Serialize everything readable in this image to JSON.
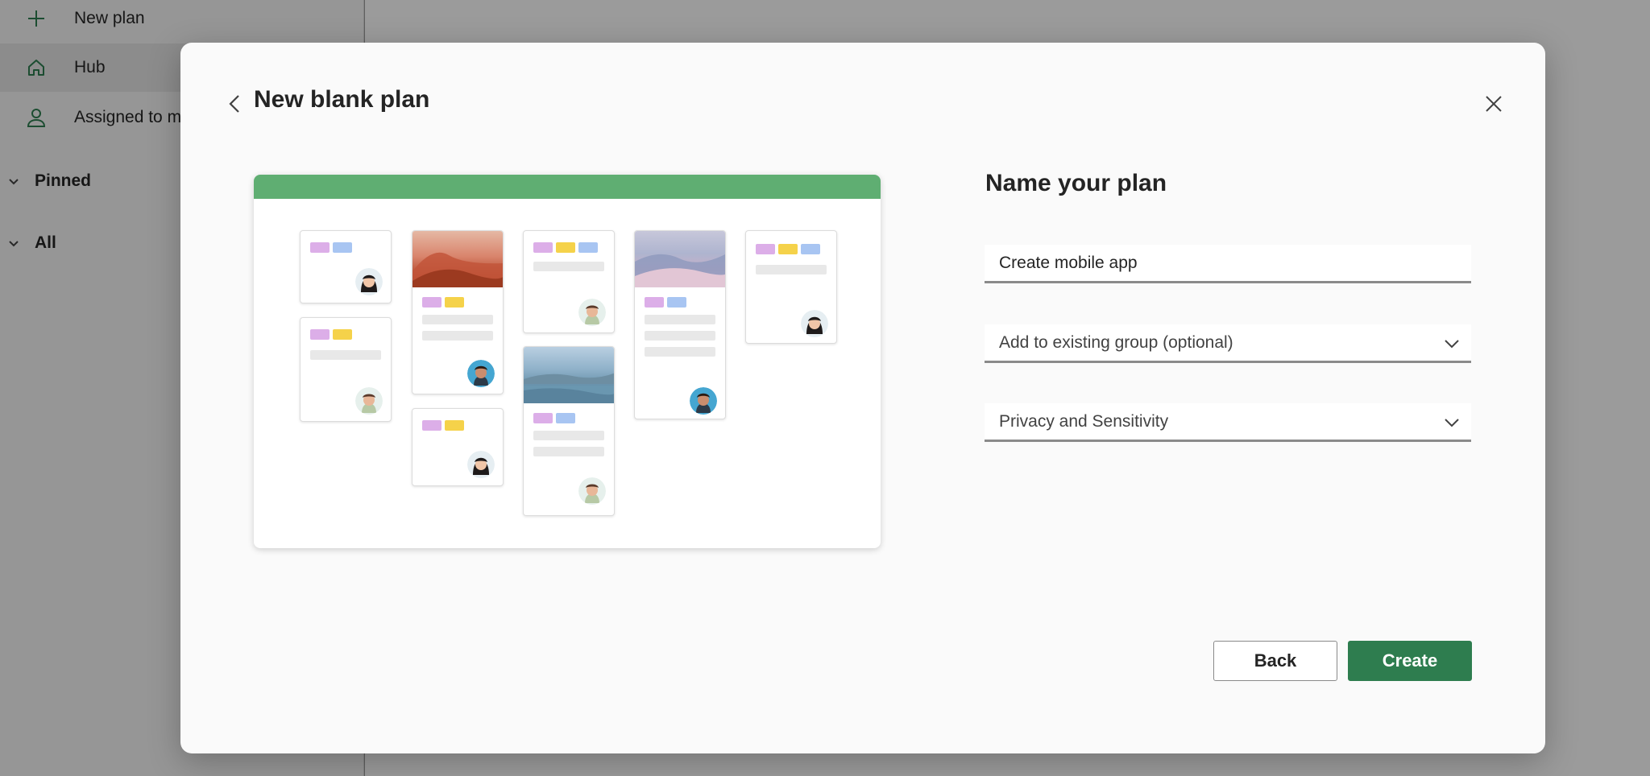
{
  "background_app": {
    "nav": [
      {
        "label": "New plan",
        "icon": "plus-icon"
      },
      {
        "label": "Hub",
        "icon": "home-icon",
        "active": true
      },
      {
        "label": "Assigned to me",
        "icon": "person-icon"
      }
    ],
    "sections": [
      {
        "label": "Pinned"
      },
      {
        "label": "All"
      }
    ]
  },
  "modal": {
    "title": "New blank plan",
    "back_icon": "chevron-left-icon",
    "close_icon": "close-icon",
    "illustration": {
      "header_color": "#5fae72",
      "description": "board-preview-illustration"
    },
    "form": {
      "heading": "Name your plan",
      "plan_name": {
        "value": "Create mobile app",
        "placeholder": "Name your plan"
      },
      "group_select": {
        "label": "Add to existing group (optional)",
        "icon": "chevron-down-icon"
      },
      "privacy_select": {
        "label": "Privacy and Sensitivity",
        "icon": "chevron-down-icon"
      }
    },
    "buttons": {
      "back": "Back",
      "create": "Create"
    }
  },
  "colors": {
    "accent": "#2e7d4f",
    "tag_pink": "#dcaee8",
    "tag_yellow": "#f5d24a",
    "tag_blue": "#a8c5f2"
  }
}
